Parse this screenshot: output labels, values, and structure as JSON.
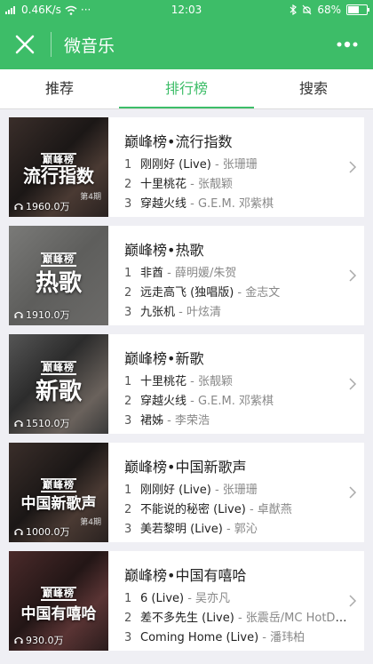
{
  "statusbar": {
    "network_speed": "0.46K/s",
    "dots": "···",
    "time": "12:03",
    "battery_text": "68%",
    "battery_level": 0.68
  },
  "navbar": {
    "title": "微音乐"
  },
  "tabs": [
    {
      "label": "推荐"
    },
    {
      "label": "排行榜"
    },
    {
      "label": "搜索"
    }
  ],
  "active_tab": 1,
  "colors": {
    "accent": "#3dbd68"
  },
  "rankings": [
    {
      "title": "巅峰榜•流行指数",
      "cover_badge": "巅峰榜",
      "cover_text": "流行指数",
      "cover_small": "第4期",
      "play_count": "1960.0万",
      "songs": [
        {
          "num": "1",
          "name": "刚刚好 (Live)",
          "artist": " - 张珊珊"
        },
        {
          "num": "2",
          "name": "十里桃花",
          "artist": " - 张靓颖"
        },
        {
          "num": "3",
          "name": "穿越火线",
          "artist": " - G.E.M. 邓紫棋"
        }
      ]
    },
    {
      "title": "巅峰榜•热歌",
      "cover_badge": "巅峰榜",
      "cover_text": "热歌",
      "cover_small": "",
      "play_count": "1910.0万",
      "songs": [
        {
          "num": "1",
          "name": "非酋",
          "artist": " - 薛明媛/朱贺"
        },
        {
          "num": "2",
          "name": "远走高飞 (独唱版)",
          "artist": " - 金志文"
        },
        {
          "num": "3",
          "name": "九张机",
          "artist": " - 叶炫清"
        }
      ]
    },
    {
      "title": "巅峰榜•新歌",
      "cover_badge": "巅峰榜",
      "cover_text": "新歌",
      "cover_small": "",
      "play_count": "1510.0万",
      "songs": [
        {
          "num": "1",
          "name": "十里桃花",
          "artist": " - 张靓颖"
        },
        {
          "num": "2",
          "name": "穿越火线",
          "artist": " - G.E.M. 邓紫棋"
        },
        {
          "num": "3",
          "name": "裙姊",
          "artist": " - 李荣浩"
        }
      ]
    },
    {
      "title": "巅峰榜•中国新歌声",
      "cover_badge": "巅峰榜",
      "cover_text": "中国新歌声",
      "cover_small": "第4期",
      "play_count": "1000.0万",
      "songs": [
        {
          "num": "1",
          "name": "刚刚好 (Live)",
          "artist": " - 张珊珊"
        },
        {
          "num": "2",
          "name": "不能说的秘密 (Live)",
          "artist": " - 卓猷燕"
        },
        {
          "num": "3",
          "name": "美若黎明 (Live)",
          "artist": " - 郭沁"
        }
      ]
    },
    {
      "title": "巅峰榜•中国有嘻哈",
      "cover_badge": "巅峰榜",
      "cover_text": "中国有嘻哈",
      "cover_small": "",
      "play_count": "930.0万",
      "songs": [
        {
          "num": "1",
          "name": "6 (Live)",
          "artist": " - 吴亦凡"
        },
        {
          "num": "2",
          "name": "差不多先生 (Live)",
          "artist": " - 张震岳/MC HotDog"
        },
        {
          "num": "3",
          "name": "Coming Home (Live)",
          "artist": " - 潘玮柏"
        }
      ]
    }
  ]
}
